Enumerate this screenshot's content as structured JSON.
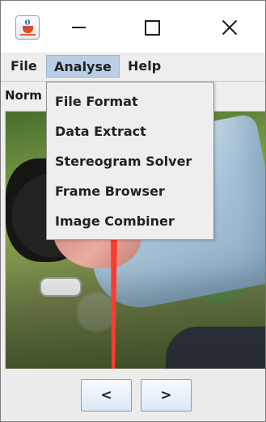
{
  "window": {
    "controls": {
      "minimize_icon": "minimize-icon",
      "maximize_icon": "maximize-icon",
      "close_icon": "close-icon"
    }
  },
  "menu_bar": {
    "file": "File",
    "analyse": "Analyse",
    "help": "Help"
  },
  "toolbar": {
    "partial_label": "Norm"
  },
  "analyse_menu": {
    "items": [
      "File Format",
      "Data Extract",
      "Stereogram Solver",
      "Frame Browser",
      "Image Combiner"
    ]
  },
  "navigation": {
    "previous": "<",
    "next": ">"
  },
  "colors": {
    "menu_highlight": "#b8cfe5",
    "arrow": "#ff3b30",
    "button_border": "#7f9dbe"
  }
}
